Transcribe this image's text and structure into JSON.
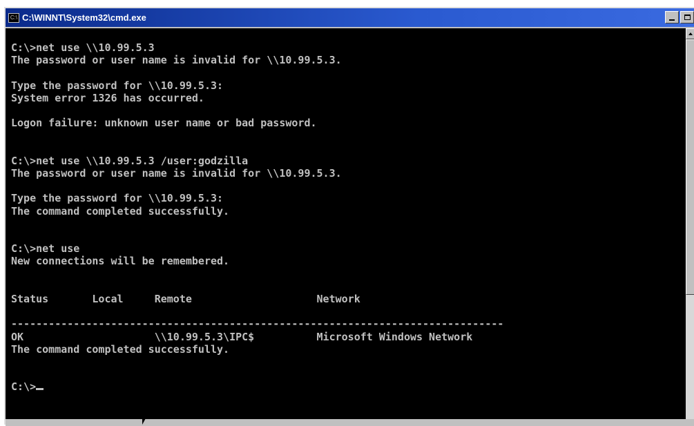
{
  "window": {
    "title": "C:\\WINNT\\System32\\cmd.exe",
    "icon_label": "C:\\"
  },
  "console": {
    "lines": [
      "C:\\>net use \\\\10.99.5.3",
      "The password or user name is invalid for \\\\10.99.5.3.",
      "",
      "Type the password for \\\\10.99.5.3:",
      "System error 1326 has occurred.",
      "",
      "Logon failure: unknown user name or bad password.",
      "",
      "",
      "C:\\>net use \\\\10.99.5.3 /user:godzilla",
      "The password or user name is invalid for \\\\10.99.5.3.",
      "",
      "Type the password for \\\\10.99.5.3:",
      "The command completed successfully.",
      "",
      "",
      "C:\\>net use",
      "New connections will be remembered.",
      "",
      "",
      "Status       Local     Remote                    Network",
      "",
      "-------------------------------------------------------------------------------",
      "OK                     \\\\10.99.5.3\\IPC$          Microsoft Windows Network",
      "The command completed successfully.",
      "",
      "",
      "C:\\>"
    ]
  },
  "colors": {
    "console_bg": "#000000",
    "console_fg": "#c0c0c0",
    "titlebar_start": "#0a2a8a",
    "titlebar_end": "#3a6ae0"
  },
  "icons": [
    "cmd-app-icon",
    "minimize-icon",
    "maximize-icon",
    "scroll-up-arrow-icon",
    "mouse-pointer-icon"
  ]
}
